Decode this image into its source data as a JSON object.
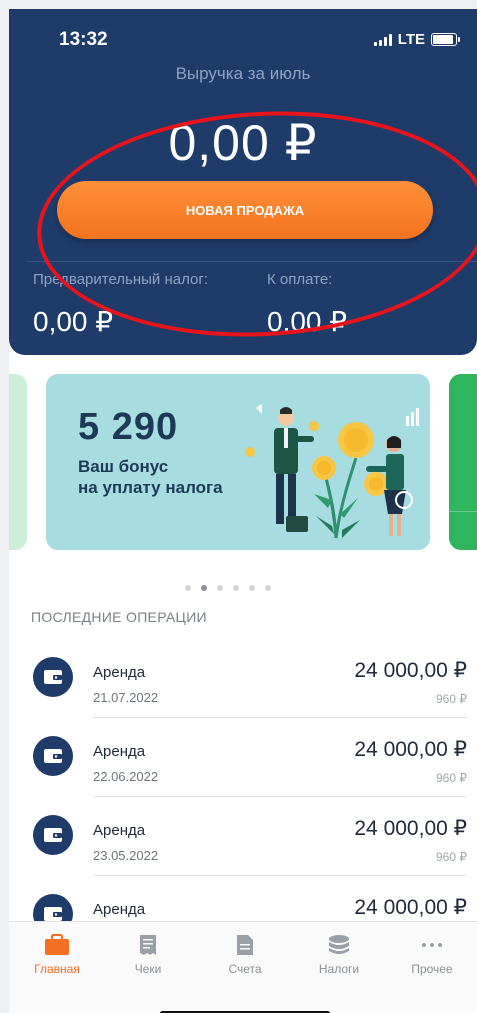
{
  "status_bar": {
    "time": "13:32",
    "network": "LTE"
  },
  "header": {
    "revenue_label": "Выручка за июль",
    "revenue_value": "0,00 ₽",
    "new_sale_button": "НОВАЯ ПРОДАЖА",
    "prepaid_tax_label": "Предварительный налог:",
    "prepaid_tax_value": "0,00 ₽",
    "to_pay_label": "К оплате:",
    "to_pay_value": "0,00 ₽"
  },
  "banner": {
    "amount": "5 290",
    "text_line1": "Ваш бонус",
    "text_line2": "на уплату налога"
  },
  "carousel": {
    "total": 6,
    "active": 1
  },
  "operations": {
    "title": "ПОСЛЕДНИЕ ОПЕРАЦИИ",
    "items": [
      {
        "name": "Аренда",
        "date": "21.07.2022",
        "amount": "24 000,00 ₽",
        "tax": "960 ₽"
      },
      {
        "name": "Аренда",
        "date": "22.06.2022",
        "amount": "24 000,00 ₽",
        "tax": "960 ₽"
      },
      {
        "name": "Аренда",
        "date": "23.05.2022",
        "amount": "24 000,00 ₽",
        "tax": "960 ₽"
      },
      {
        "name": "Аренда",
        "date": "",
        "amount": "24 000,00 ₽",
        "tax": ""
      }
    ]
  },
  "tabbar": {
    "items": [
      {
        "label": "Главная",
        "icon": "briefcase-icon",
        "active": true
      },
      {
        "label": "Чеки",
        "icon": "receipt-icon",
        "active": false
      },
      {
        "label": "Счета",
        "icon": "document-icon",
        "active": false
      },
      {
        "label": "Налоги",
        "icon": "coins-icon",
        "active": false
      },
      {
        "label": "Прочее",
        "icon": "more-icon",
        "active": false
      }
    ]
  },
  "colors": {
    "header": "#1f3b6a",
    "accent": "#f36f21",
    "annotation": "#e8141b"
  }
}
